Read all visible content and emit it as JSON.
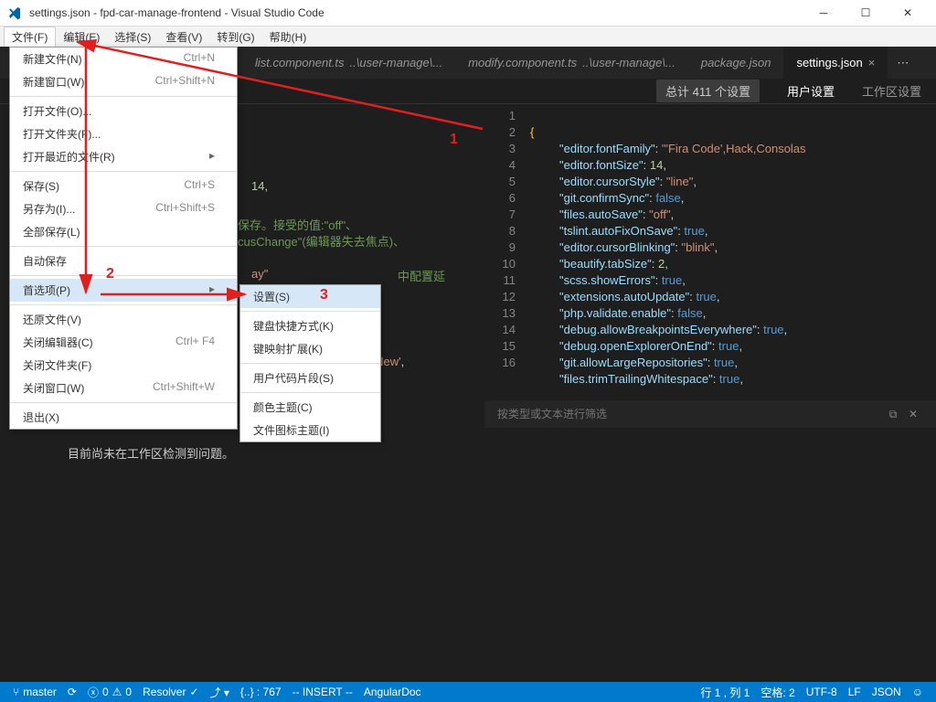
{
  "window": {
    "title": "settings.json - fpd-car-manage-frontend - Visual Studio Code"
  },
  "menubar": {
    "file": "文件(F)",
    "edit": "编辑(E)",
    "select": "选择(S)",
    "view": "查看(V)",
    "goto": "转到(G)",
    "help": "帮助(H)"
  },
  "tabs": {
    "t1": "list.component.ts",
    "t1sub": "..\\user-manage\\...",
    "t2": "modify.component.ts",
    "t2sub": "..\\user-manage\\...",
    "t3": "package.json",
    "t4": "settings.json"
  },
  "settingsbar": {
    "count": "总计 411 个设置",
    "user": "用户设置",
    "ws": "工作区设置"
  },
  "lines": [
    "1",
    "2",
    "3",
    "4",
    "5",
    "6",
    "7",
    "8",
    "9",
    "10",
    "11",
    "12",
    "13",
    "14",
    "15",
    "16"
  ],
  "code": {
    "l1": "{",
    "k2": "\"editor.fontFamily\"",
    "v2": "\"'Fira Code',Hack,Consolas",
    "k3": "\"editor.fontSize\"",
    "v3": "14",
    "k4": "\"editor.cursorStyle\"",
    "v4": "\"line\"",
    "k5": "\"git.confirmSync\"",
    "v5": "false",
    "k6": "\"files.autoSave\"",
    "v6": "\"off\"",
    "k7": "\"tslint.autoFixOnSave\"",
    "v7": "true",
    "k8": "\"editor.cursorBlinking\"",
    "v8": "\"blink\"",
    "k9": "\"beautify.tabSize\"",
    "v9": "2",
    "k10": "\"scss.showErrors\"",
    "v10": "true",
    "k11": "\"extensions.autoUpdate\"",
    "v11": "true",
    "k12": "\"php.validate.enable\"",
    "v12": "false",
    "k13": "\"debug.allowBreakpointsEverywhere\"",
    "v13": "true",
    "k14": "\"debug.openExplorerOnEnd\"",
    "v14": "true",
    "k15": "\"git.allowLargeRepositories\"",
    "v15": "true",
    "k16": "\"files.trimTrailingWhitespace\"",
    "v16": "true"
  },
  "bghint": {
    "a": "保存。接受的值:\"off\"、",
    "b": "cusChange\"(编辑器失去焦点)、",
    "c": "ay\"",
    "c2": " 中配置延",
    "d": "er New'",
    "e": "14,"
  },
  "filter": {
    "placeholder": "按类型或文本进行筛选"
  },
  "problems": "目前尚未在工作区检测到问题。",
  "menu1": {
    "newfile": "新建文件(N)",
    "newfile_s": "Ctrl+N",
    "newwin": "新建窗口(W)",
    "newwin_s": "Ctrl+Shift+N",
    "openfile": "打开文件(O)...",
    "openfolder": "打开文件夹(F)...",
    "openrecent": "打开最近的文件(R)",
    "save": "保存(S)",
    "save_s": "Ctrl+S",
    "saveas": "另存为(I)...",
    "saveas_s": "Ctrl+Shift+S",
    "saveall": "全部保存(L)",
    "autosave": "自动保存",
    "prefs": "首选项(P)",
    "revert": "还原文件(V)",
    "closeeditor": "关闭编辑器(C)",
    "closeeditor_s": "Ctrl+ F4",
    "closefolder": "关闭文件夹(F)",
    "closewin": "关闭窗口(W)",
    "closewin_s": "Ctrl+Shift+W",
    "exit": "退出(X)"
  },
  "menu2": {
    "settings": "设置(S)",
    "kbshort": "键盘快捷方式(K)",
    "keymap": "键映射扩展(K)",
    "snippets": "用户代码片段(S)",
    "colortheme": "颜色主题(C)",
    "icontheme": "文件图标主题(I)"
  },
  "anno": {
    "n1": "1",
    "n2": "2",
    "n3": "3"
  },
  "status": {
    "branch": "master",
    "errors": "0",
    "warnings": "0",
    "resolver": "Resolver",
    "lines": "{..} : 767",
    "insert": "-- INSERT --",
    "angular": "AngularDoc",
    "pos": "行 1 , 列 1",
    "spaces": "空格: 2",
    "enc": "UTF-8",
    "eol": "LF",
    "lang": "JSON"
  }
}
